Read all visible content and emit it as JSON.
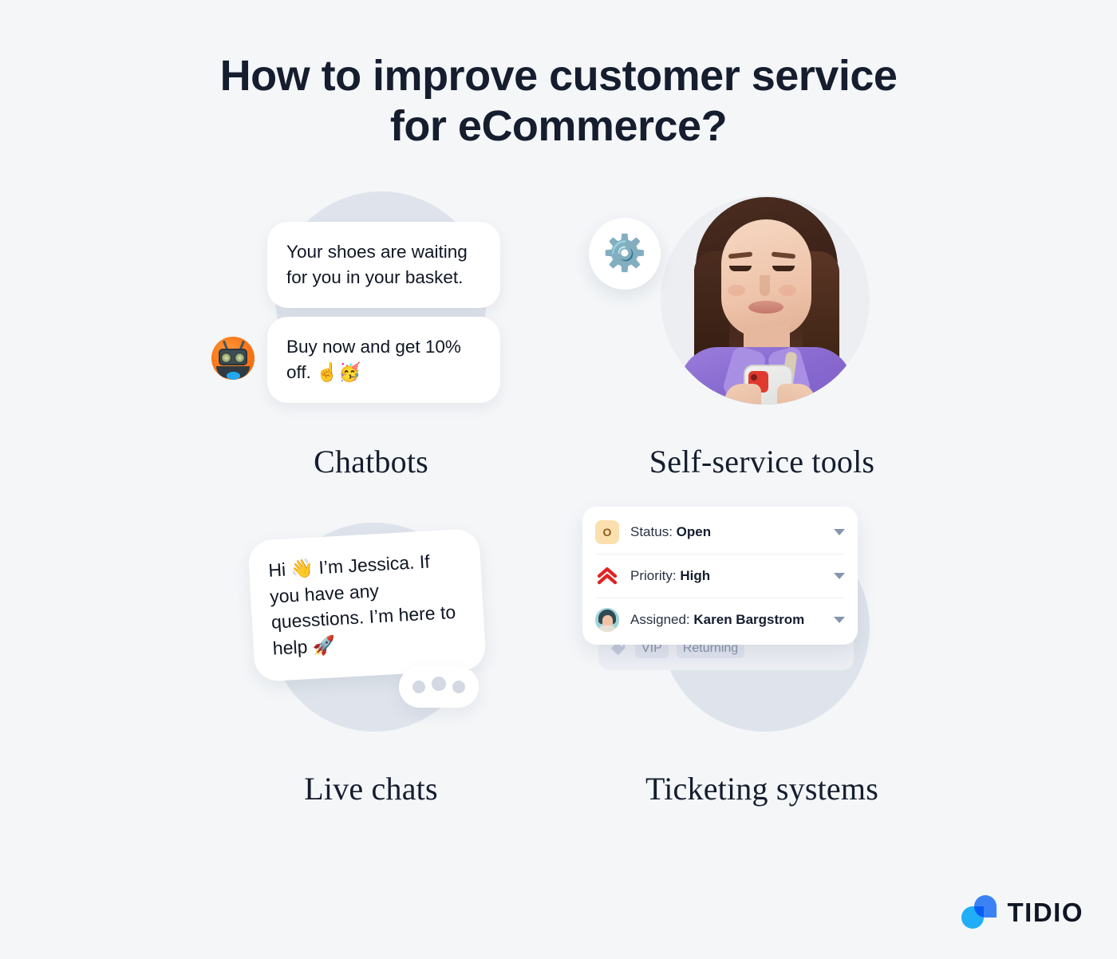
{
  "title": {
    "line1": "How to improve customer service",
    "line2": "for eCommerce?"
  },
  "sections": {
    "chatbots": {
      "caption": "Chatbots",
      "messages": [
        "Your shoes are waiting for you in your basket.",
        "Buy now and get 10% off. ☝️🥳"
      ],
      "avatar_icon": "robot-avatar"
    },
    "self_service": {
      "caption": "Self-service tools",
      "badge_icon": "⚙️",
      "photo_alt": "woman-using-phone"
    },
    "live_chats": {
      "caption": "Live chats",
      "message": "Hi 👋 I’m Jessica. If you have any quesstions. I’m here to help 🚀",
      "typing_indicator": "typing-dots"
    },
    "ticketing": {
      "caption": "Ticketing systems",
      "rows": [
        {
          "icon": "status-open-icon",
          "prefix": "Status: ",
          "value": "Open"
        },
        {
          "icon": "priority-high-icon",
          "prefix": "Priority: ",
          "value": "High"
        },
        {
          "icon": "assignee-avatar-icon",
          "prefix": "Assigned: ",
          "value": "Karen Bargstrom"
        }
      ],
      "status_badge_letter": "O",
      "tags": [
        "VIP",
        "Returning"
      ],
      "tag_icon": "tag-icon"
    }
  },
  "logo": {
    "text": "TIDIO"
  },
  "colors": {
    "background": "#f4f6f8",
    "text": "#151d2e",
    "blob": "#dfe4ec",
    "blob_light": "#eceef2",
    "status_amber": "#fcdfae",
    "priority_red": "#e02424",
    "logo_blue": "#3b82f6",
    "logo_cyan": "#22b5ff"
  }
}
